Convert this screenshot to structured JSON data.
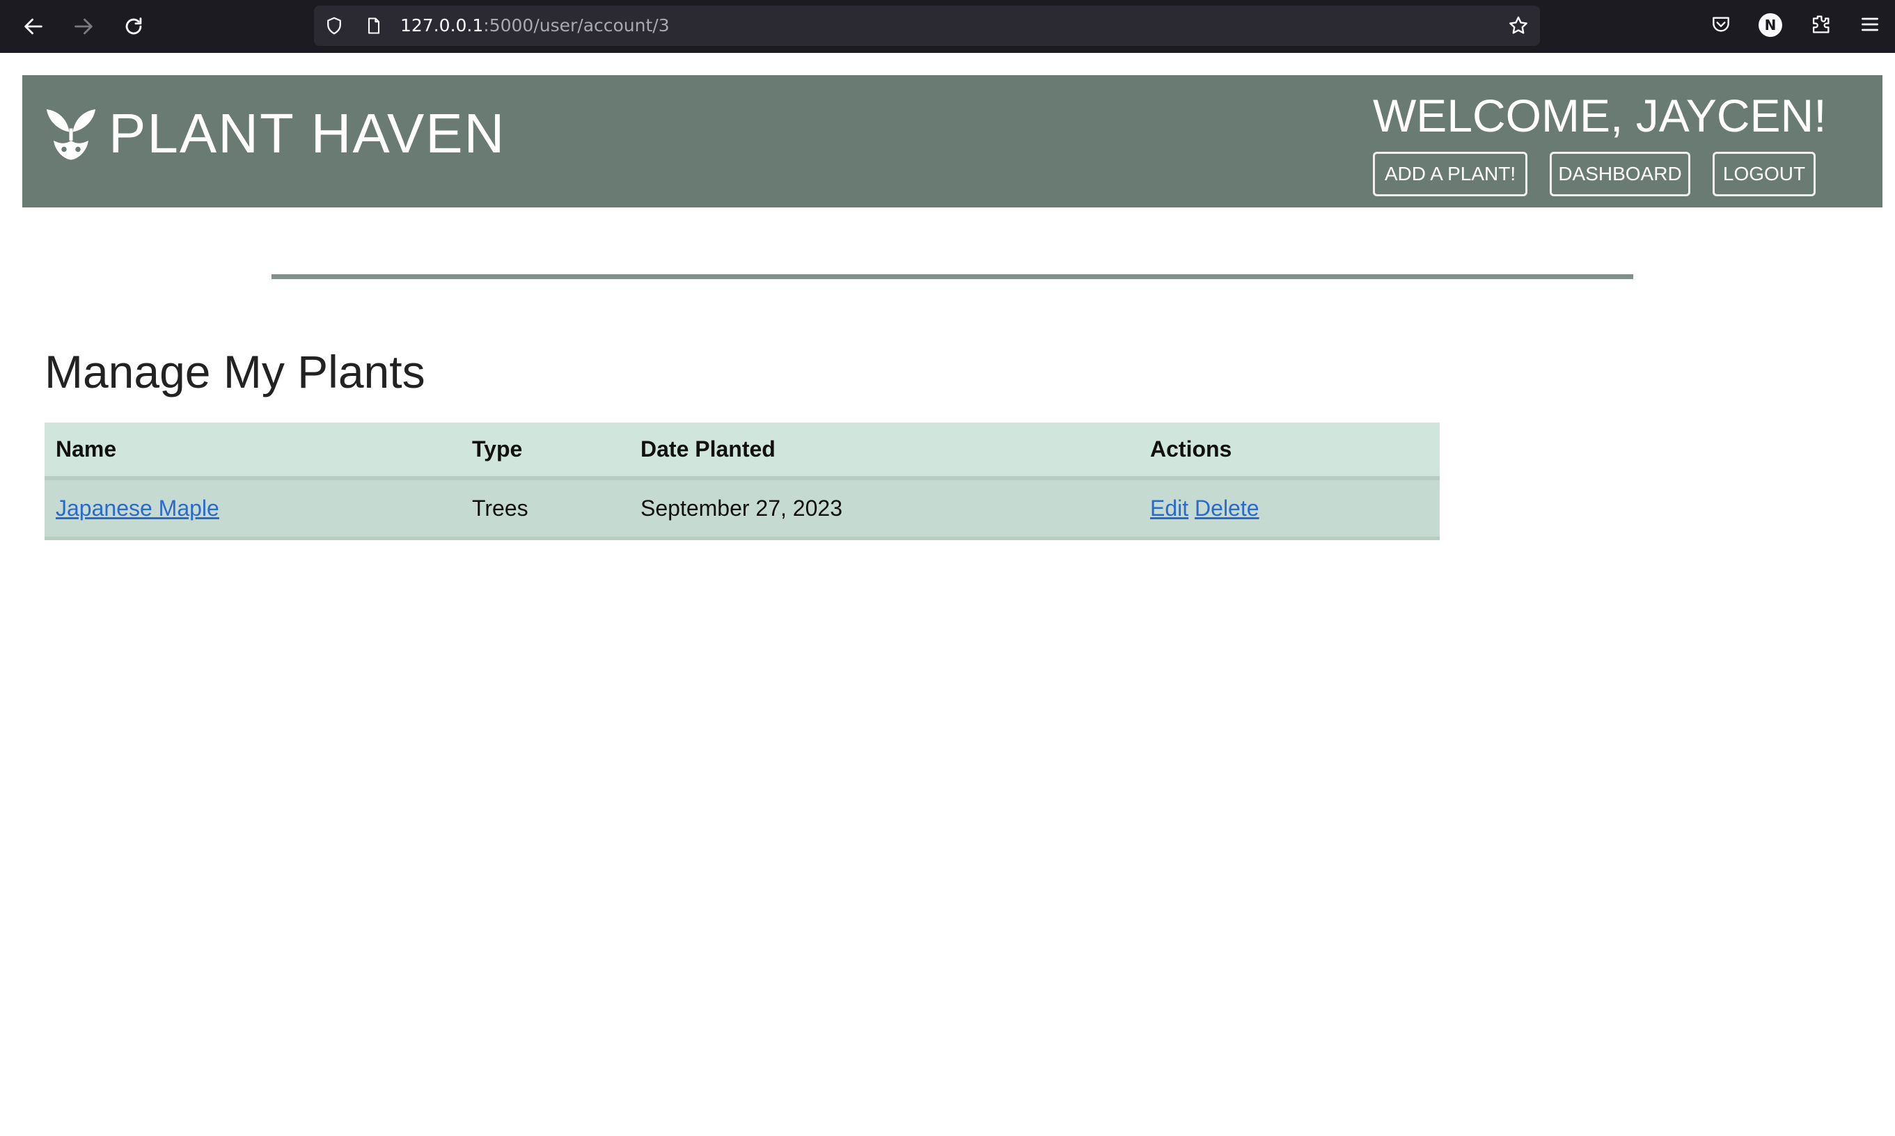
{
  "browser": {
    "url_host": "127.0.0.1",
    "url_path": ":5000/user/account/3",
    "profile_initial": "N"
  },
  "header": {
    "brand": "PLANT HAVEN",
    "welcome": "WELCOME, JAYCEN!",
    "buttons": {
      "add_plant": "ADD A PLANT!",
      "dashboard": "DASHBOARD",
      "logout": "LOGOUT"
    }
  },
  "main": {
    "title": "Manage My Plants",
    "table": {
      "columns": [
        "Name",
        "Type",
        "Date Planted",
        "Actions"
      ],
      "rows": [
        {
          "name": "Japanese Maple",
          "type": "Trees",
          "date_planted": "September 27, 2023",
          "edit_label": "Edit",
          "delete_label": "Delete"
        }
      ]
    }
  },
  "colors": {
    "header_bg": "#6a7b74",
    "table_head_bg": "#d0e5dc",
    "table_row_bg": "#c5dad1",
    "link": "#2a6ad0"
  }
}
